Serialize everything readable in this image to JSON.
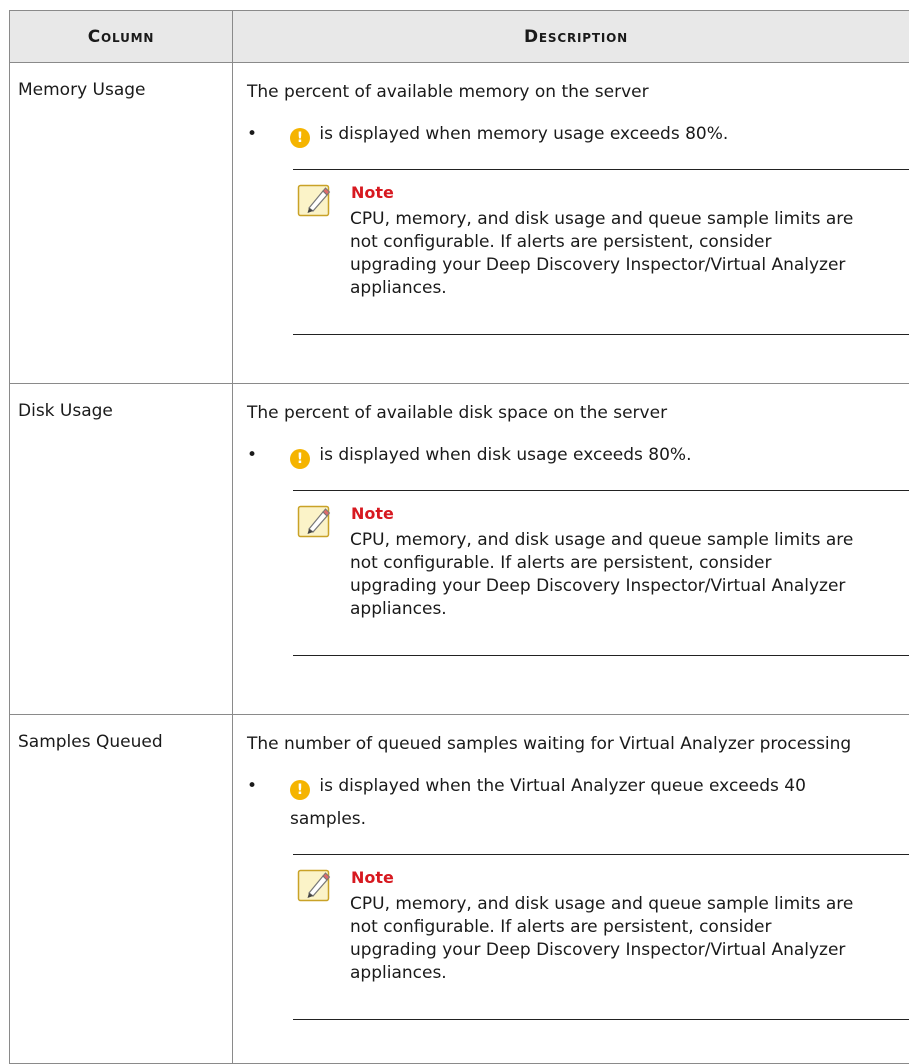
{
  "table": {
    "headers": [
      "Column",
      "Description"
    ],
    "rows": [
      {
        "column": "Memory Usage",
        "description": "The percent of available memory on the server",
        "bullet": "is displayed when memory usage exceeds 80%.",
        "note_title": "Note",
        "note_lines": [
          "CPU, memory, and disk usage and queue sample limits are",
          "not configurable. If alerts are persistent, consider",
          "upgrading your Deep Discovery Inspector/Virtual Analyzer",
          "appliances."
        ]
      },
      {
        "column": "Disk Usage",
        "description": "The percent of available disk space on the server",
        "bullet": "is displayed when disk usage exceeds 80%.",
        "note_title": "Note",
        "note_lines": [
          "CPU, memory, and disk usage and queue sample limits are",
          "not configurable. If alerts are persistent, consider",
          "upgrading your Deep Discovery Inspector/Virtual Analyzer",
          "appliances."
        ]
      },
      {
        "column": "Samples Queued",
        "description": "The number of queued samples waiting for Virtual Analyzer processing",
        "bullet": "is displayed when the Virtual Analyzer queue exceeds 40 samples.",
        "note_title": "Note",
        "note_lines": [
          "CPU, memory, and disk usage and queue sample limits are",
          "not configurable. If alerts are persistent, consider",
          "upgrading your Deep Discovery Inspector/Virtual Analyzer",
          "appliances."
        ]
      }
    ]
  },
  "icons": {
    "warning": "warning-icon",
    "note": "note-pencil-icon"
  },
  "colors": {
    "header_bg": "#e8e8e8",
    "note_title": "#d71920",
    "warning": "#f5b400"
  }
}
